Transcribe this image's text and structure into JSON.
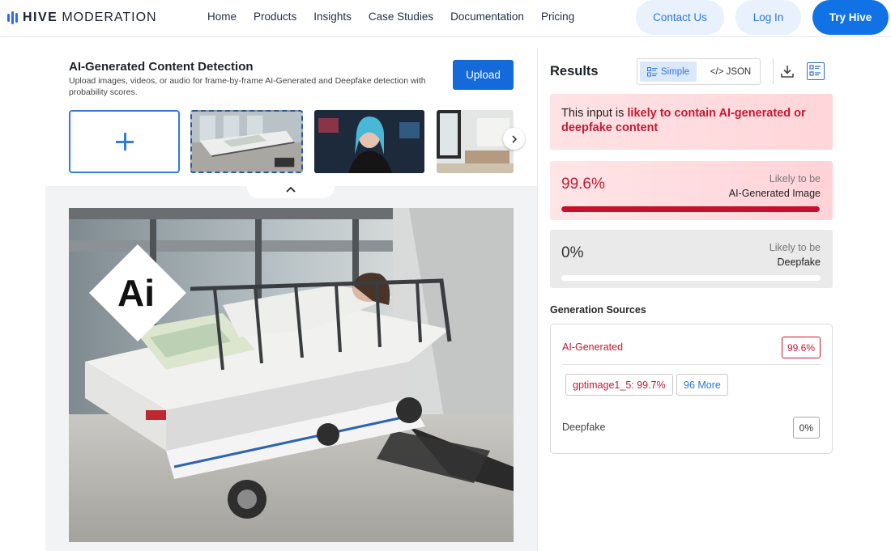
{
  "header": {
    "logo_primary": "HIVE",
    "logo_secondary": "MODERATION",
    "nav": [
      "Home",
      "Products",
      "Insights",
      "Case Studies",
      "Documentation",
      "Pricing"
    ],
    "contact_label": "Contact Us",
    "login_label": "Log In",
    "try_label": "Try Hive"
  },
  "detector": {
    "title": "AI-Generated Content Detection",
    "description": "Upload images, videos, or audio for frame-by-frame AI-Generated and Deepfake detection with probability scores.",
    "upload_label": "Upload"
  },
  "main_image": {
    "watermark_text": "Ai"
  },
  "results": {
    "title": "Results",
    "view_simple": "Simple",
    "view_json": "</> JSON",
    "verdict_prefix": "This input is ",
    "verdict_emphasis": "likely to contain AI-generated or deepfake content",
    "ai_score": {
      "percent": "99.6%",
      "likely_line1": "Likely to be",
      "likely_line2": "AI-Generated Image",
      "value": 0.996
    },
    "deepfake_score": {
      "percent": "0%",
      "likely_line1": "Likely to be",
      "likely_line2": "Deepfake",
      "value": 0
    },
    "generation_sources_title": "Generation Sources",
    "sources": {
      "ai_label": "AI-Generated",
      "ai_value": "99.6%",
      "top_source": "gptimage1_5: 99.7%",
      "more_label": "96 More",
      "deepfake_label": "Deepfake",
      "deepfake_value": "0%"
    }
  },
  "colors": {
    "brand_blue": "#1072e5",
    "alert_red": "#c41a35"
  }
}
